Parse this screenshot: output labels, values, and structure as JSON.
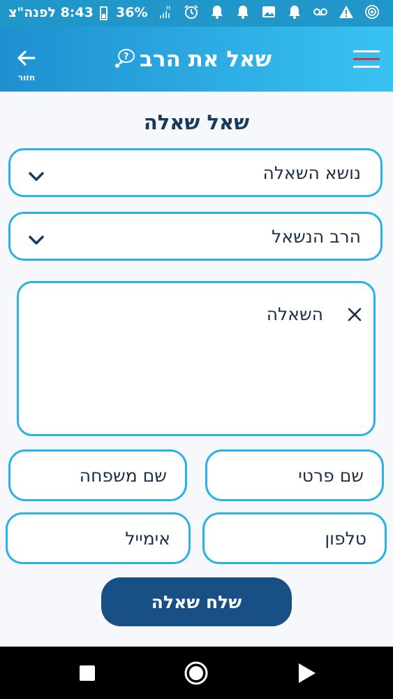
{
  "status_bar": {
    "time": "8:43 לפנה\"צ",
    "battery": "36%",
    "icons": [
      "signal-h-icon",
      "alarm-icon",
      "notification-bell-icon",
      "notification-bell-icon",
      "image-icon",
      "notification-bell-icon",
      "voicemail-icon",
      "warning-icon",
      "hotspot-icon"
    ]
  },
  "header": {
    "back_label": "חזור",
    "title": "שאל את הרב",
    "menu_accent": "#e0313a"
  },
  "form": {
    "page_title": "שאל שאלה",
    "topic_placeholder": "נושא השאלה",
    "rabbi_placeholder": "הרב הנשאל",
    "question_placeholder": "השאלה",
    "first_name_placeholder": "שם פרטי",
    "last_name_placeholder": "שם משפחה",
    "phone_placeholder": "טלפון",
    "email_placeholder": "אימייל",
    "submit_label": "שלח שאלה"
  },
  "colors": {
    "header_gradient_start": "#1f8fd0",
    "header_gradient_end": "#38c3f2",
    "field_border": "#28b2e6",
    "submit_bg": "#184f84",
    "title_text": "#173a5e"
  }
}
